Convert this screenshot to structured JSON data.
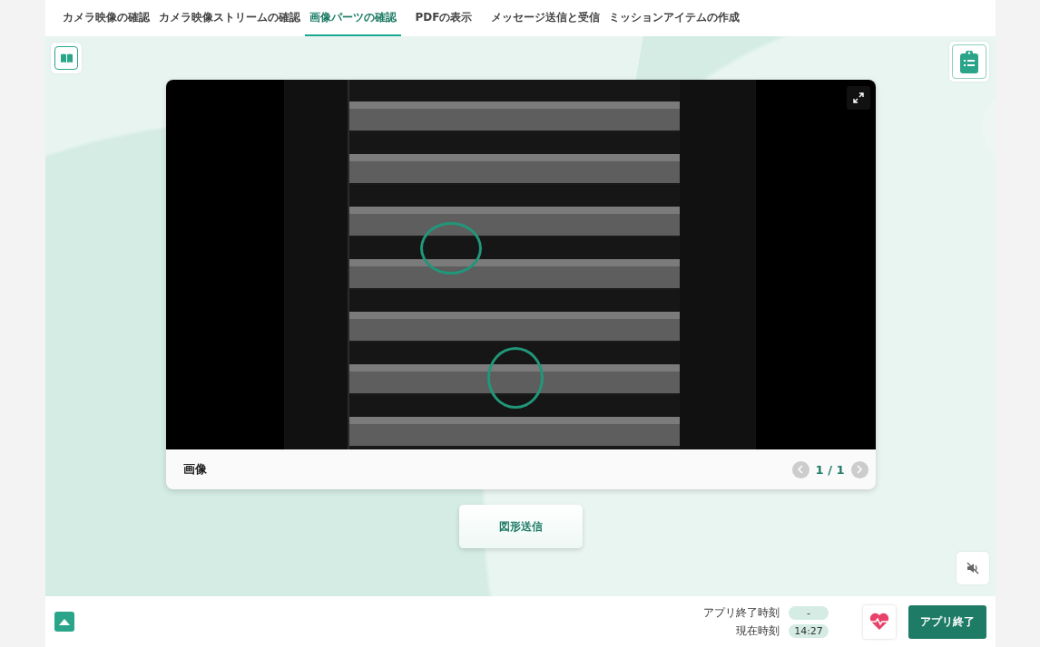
{
  "tabs": [
    {
      "label": "カメラ映像の確認",
      "selected": false
    },
    {
      "label": "カメラ映像ストリームの確認",
      "selected": false
    },
    {
      "label": "画像パーツの確認",
      "selected": true
    },
    {
      "label": "PDFの表示",
      "selected": false
    },
    {
      "label": "メッセージ送信と受信",
      "selected": false
    },
    {
      "label": "ミッションアイテムの作成",
      "selected": false
    }
  ],
  "viewer": {
    "caption": "画像",
    "page": "1 / 1",
    "prev": {
      "disabled": true
    },
    "next": {
      "disabled": true
    }
  },
  "send_button": "図形送信",
  "footer": {
    "times": [
      {
        "label": "アプリ終了時刻",
        "value": "-"
      },
      {
        "label": "現在時刻",
        "value": "14:27"
      }
    ],
    "end_button": "アプリ終了"
  }
}
